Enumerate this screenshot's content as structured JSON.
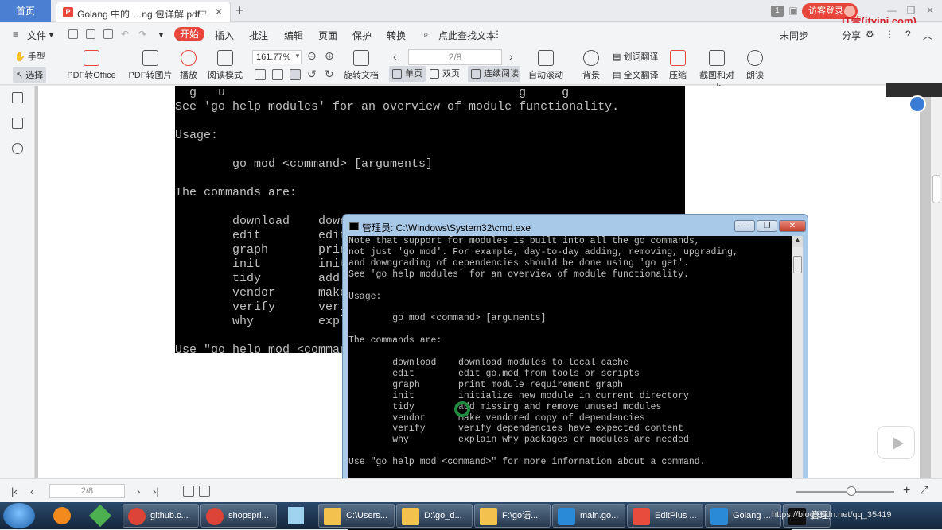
{
  "titlebar": {
    "home_tab": "首页",
    "doc_tab": "Golang 中的 …ng 包详解.pdf",
    "pdf_badge": "P",
    "page_count": "1",
    "login": "访客登录",
    "watermark": "IT营(ityinj.com)"
  },
  "menubar": {
    "file": "文件",
    "active": "开始",
    "items": [
      "插入",
      "批注",
      "编辑",
      "页面",
      "保护",
      "转换"
    ],
    "search": "点此查找文本",
    "right": [
      "未同步",
      "分享"
    ]
  },
  "toolbar": {
    "hand": "手型",
    "select": "选择",
    "pdf_office": "PDF转Office",
    "pdf_image": "PDF转图片",
    "play": "播放",
    "read_mode": "阅读模式",
    "zoom": "161.77%",
    "rotate": "旋转文档",
    "page_input": "2/8",
    "single": "单页",
    "double": "双页",
    "continuous": "连续阅读",
    "auto_scroll": "自动滚动",
    "background": "背景",
    "word_translate": "划词翻译",
    "full_translate": "全文翻译",
    "compress": "压缩",
    "screenshot": "截图和对比",
    "read_aloud": "朗读"
  },
  "embedded_text": "  g   u                                         g     g\nSee 'go help modules' for an overview of module functionality.\n\nUsage:\n\n        go mod <command> [arguments]\n\nThe commands are:\n\n        download    download modules to local cache\n        edit        edit go.mod from tools or scripts\n        graph       print module requirement graph\n        init        initialize new module in current directory\n        tidy        add missing and remove unused modules\n        vendor      make vendored copy of dependencies\n        verify      verify dependencies have expected content\n        why         explain why packages or modules are needed\n\nUse \"go help mod <command>\" for more information about a command.",
  "cmd": {
    "title": "管理员: C:\\Windows\\System32\\cmd.exe",
    "body": "Note that support for modules is built into all the go commands,\nnot just 'go mod'. For example, day-to-day adding, removing, upgrading,\nand downgrading of dependencies should be done using 'go get'.\nSee 'go help modules' for an overview of module functionality.\n\nUsage:\n\n        go mod <command> [arguments]\n\nThe commands are:\n\n        download    download modules to local cache\n        edit        edit go.mod from tools or scripts\n        graph       print module requirement graph\n        init        initialize new module in current directory\n        tidy        add missing and remove unused modules\n        vendor      make vendored copy of dependencies\n        verify      verify dependencies have expected content\n        why         explain why packages or modules are needed\n\nUse \"go help mod <command>\" for more information about a command."
  },
  "statusbar": {
    "page_input": "2/8"
  },
  "taskbar": {
    "tasks": [
      "github.c...",
      "shopspri...",
      "C:\\Users...",
      "D:\\go_d...",
      "F:\\go语...",
      "main.go...",
      "EditPlus ...",
      "Golang ...",
      "管理员..."
    ],
    "sysinfo": "https://blog.csdn.net/qq_35419"
  }
}
